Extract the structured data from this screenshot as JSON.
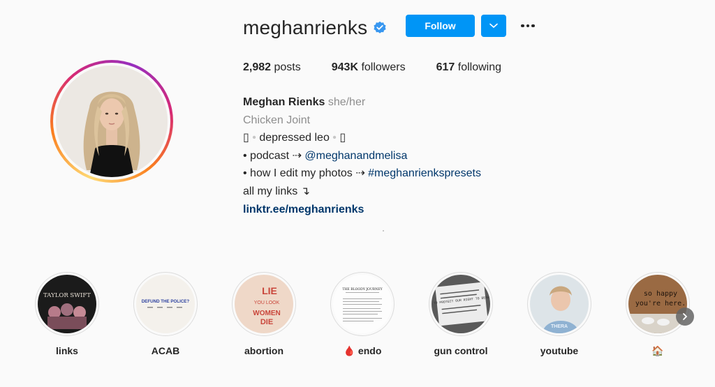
{
  "profile": {
    "username": "meghanrienks",
    "follow_label": "Follow",
    "stats": {
      "posts_count": "2,982",
      "posts_label": "posts",
      "followers_count": "943K",
      "followers_label": "followers",
      "following_count": "617",
      "following_label": "following"
    },
    "bio": {
      "name": "Meghan Rienks",
      "pronouns": "she/her",
      "category": "Chicken Joint",
      "line1_left": "▯",
      "line1_sep": "•",
      "line1_text": "depressed leo",
      "line1_right": "▯",
      "line2_prefix": "• podcast ⇢",
      "line2_link": "@meghanandmelisa",
      "line3_prefix": "• how I edit my photos ⇢",
      "line3_link": "#meghanrienkspresets",
      "line4": "all my links ↴",
      "website": "linktr.ee/meghanrienks"
    }
  },
  "highlights": [
    {
      "label": "links",
      "img_text": "TAYLOR SWIFT"
    },
    {
      "label": "ACAB",
      "img_text": "DEFUND THE POLICE?"
    },
    {
      "label": "abortion",
      "img_text_1": "LIE",
      "img_text_2": "YOU LOOK",
      "img_text_3": "WOMEN",
      "img_text_4": "DIE"
    },
    {
      "label": "🩸 endo",
      "img_text": "THE BLOODY JOURNEY"
    },
    {
      "label": "gun control",
      "img_text": "FORCE TO PROTECT OUR RIGHT TO BEAR ARMS"
    },
    {
      "label": "youtube",
      "img_text": "THERA"
    },
    {
      "label": "🏠",
      "img_text_1": "so happy",
      "img_text_2": "you're here."
    }
  ],
  "colors": {
    "follow_blue": "#0095f6",
    "verified_blue": "#3897f0",
    "link_blue": "#00376b"
  },
  "icons": {
    "verified": "verified-badge-icon",
    "dropdown": "chevron-down-icon",
    "more": "more-options-icon",
    "next": "chevron-right-icon"
  }
}
